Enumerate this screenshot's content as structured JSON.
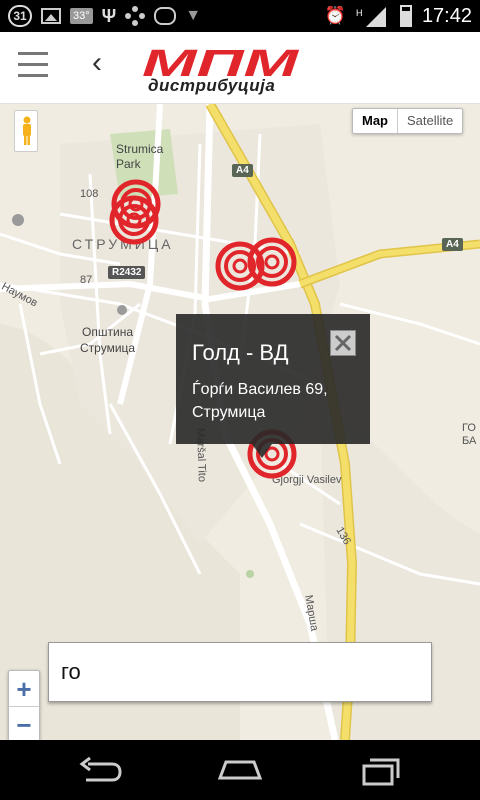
{
  "status_bar": {
    "calendar_day": "31",
    "temperature": "33°",
    "network_label": "H",
    "time": "17:42"
  },
  "app_bar": {
    "logo_mark": "МПМ",
    "logo_text": "дистрибуција"
  },
  "map": {
    "type_options": [
      "Map",
      "Satellite"
    ],
    "active_type": "Map",
    "labels": {
      "park": "Strumica\nPark",
      "city": "СТРУМИЦА",
      "municipality": "Општина\nСтрумица",
      "naumov": "Наумов",
      "tito": "Maršal Tito",
      "gorgji": "Gjorgji Vasilev",
      "marsha": "Марша",
      "num_108": "108",
      "num_87": "87",
      "num_136": "136",
      "edge": "ГО\nБА"
    },
    "road_badges": {
      "a4_top": "A4",
      "a4_right": "A4",
      "r2432": "R2432"
    },
    "markers": [
      "store-marker",
      "store-marker",
      "store-marker",
      "store-marker"
    ],
    "zoom_in": "+",
    "zoom_out": "−"
  },
  "info_window": {
    "title": "Голд - ВД",
    "address": "Ѓорѓи Василев 69, Струмица"
  },
  "search": {
    "value": "го"
  },
  "colors": {
    "accent_red": "#e1262b",
    "map_bg": "#f0ece2",
    "highway": "#f4df6b"
  }
}
